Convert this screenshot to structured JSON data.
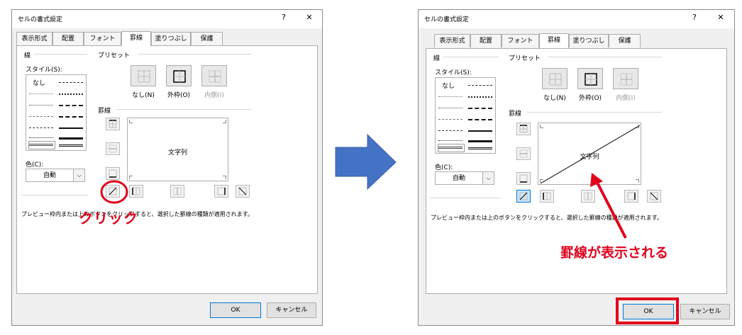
{
  "dialog": {
    "title": "セルの書式設定",
    "help_glyph": "?",
    "close_glyph": "✕",
    "tabs": [
      "表示形式",
      "配置",
      "フォント",
      "罫線",
      "塗りつぶし",
      "保護"
    ],
    "active_tab": "罫線",
    "line_group": "線",
    "style_label": "スタイル(S):",
    "style_none": "なし",
    "color_label": "色(C):",
    "color_value": "自動",
    "preset_group": "プリセット",
    "presets": [
      "なし(N)",
      "外枠(O)",
      "内側(I)"
    ],
    "border_group": "罫線",
    "preview_text": "文字列",
    "hint": "プレビュー枠内または上のボタンをクリックすると、選択した罫線の種類が適用されます。",
    "ok": "OK",
    "cancel": "キャンセル"
  },
  "annotations": {
    "click_label": "クリック",
    "result_label": "罫線が表示される"
  },
  "colors": {
    "annotation_red": "#e0001c",
    "arrow_blue": "#4472c4",
    "selection_blue": "#0078d7"
  },
  "icons": [
    "help-icon",
    "close-icon",
    "dropdown-arrow-icon",
    "preset-none-icon",
    "preset-outline-icon",
    "preset-inside-icon",
    "border-top-icon",
    "border-middle-horizontal-icon",
    "border-bottom-icon",
    "diagonal-up-icon",
    "border-left-icon",
    "border-middle-vertical-icon",
    "border-right-icon",
    "diagonal-down-icon",
    "right-arrow-icon"
  ]
}
